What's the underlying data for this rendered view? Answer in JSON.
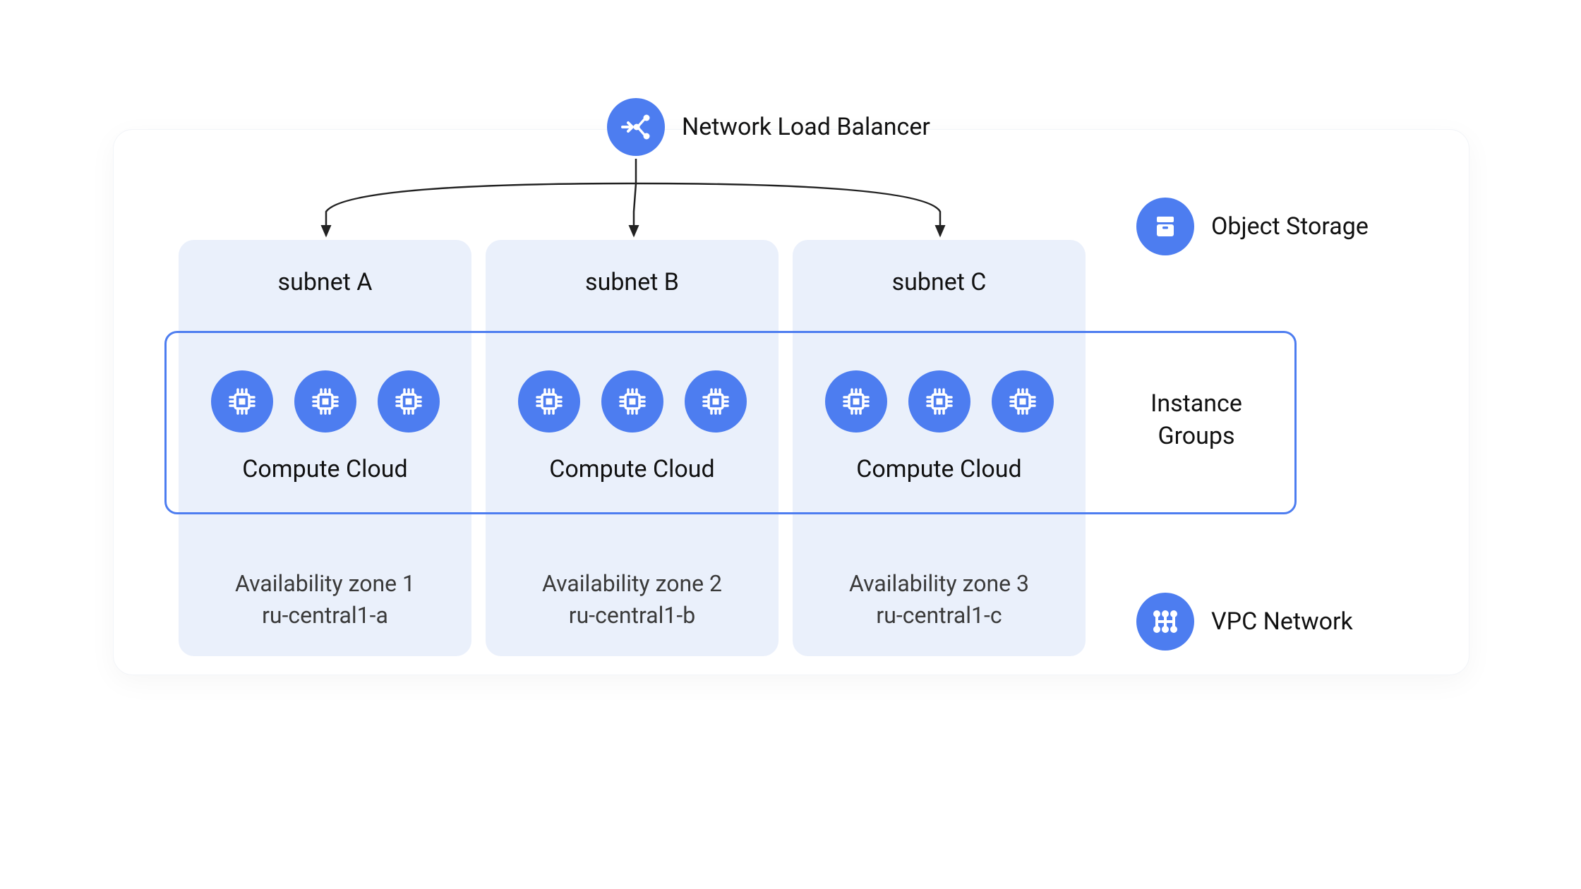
{
  "colors": {
    "accent": "#4d7df0",
    "subnet_bg": "#eaf0fb",
    "panel_border": "#f2f4f8",
    "instance_border": "#4d7df0",
    "text": "#111111"
  },
  "loadBalancer": {
    "label": "Network Load Balancer",
    "icon": "load-balancer-icon"
  },
  "objectStorage": {
    "label": "Object Storage",
    "icon": "storage-icon"
  },
  "vpcNetwork": {
    "label": "VPC Network",
    "icon": "vpc-network-icon"
  },
  "instanceGroups": {
    "label_line1": "Instance",
    "label_line2": "Groups"
  },
  "subnets": [
    {
      "title": "subnet A",
      "compute_label": "Compute Cloud",
      "az_line1": "Availability zone 1",
      "az_line2": "ru-central1-a",
      "instance_count": 3
    },
    {
      "title": "subnet B",
      "compute_label": "Compute Cloud",
      "az_line1": "Availability zone 2",
      "az_line2": "ru-central1-b",
      "instance_count": 3
    },
    {
      "title": "subnet C",
      "compute_label": "Compute Cloud",
      "az_line1": "Availability zone 3",
      "az_line2": "ru-central1-c",
      "instance_count": 3
    }
  ]
}
